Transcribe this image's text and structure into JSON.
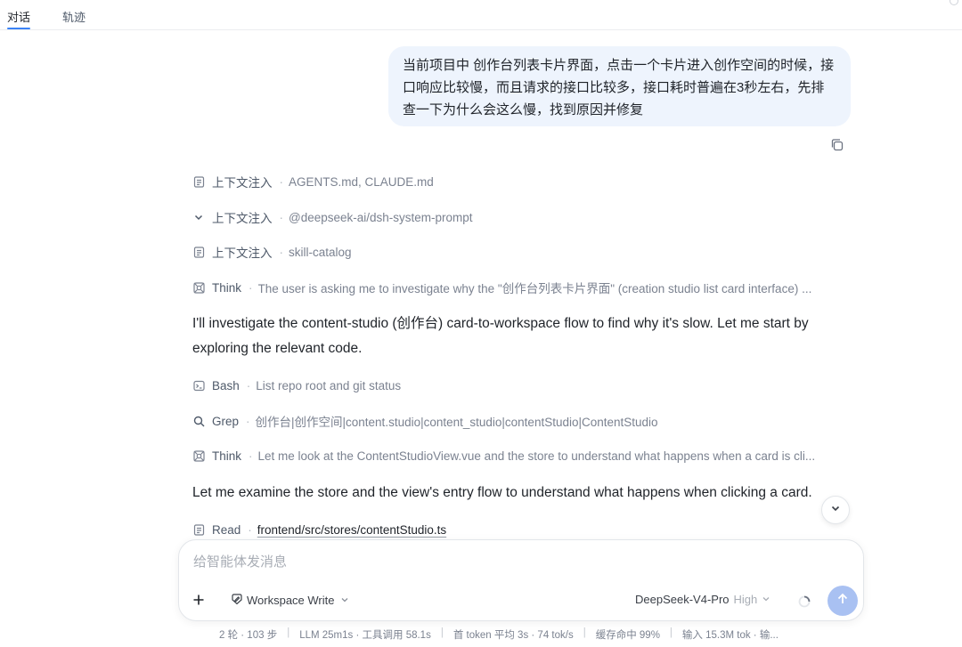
{
  "tabs": [
    {
      "label": "对话",
      "active": true
    },
    {
      "label": "轨迹",
      "active": false
    }
  ],
  "user_message": "当前项目中 创作台列表卡片界面，点击一个卡片进入创作空间的时候，接口响应比较慢，而且请求的接口比较多，接口耗时普遍在3秒左右，先排查一下为什么会这么慢，找到原因并修复",
  "steps": [
    {
      "icon": "document-icon",
      "label": "上下文注入",
      "detail": "AGENTS.md, CLAUDE.md"
    },
    {
      "icon": "chevron-down-icon",
      "label": "上下文注入",
      "detail": "@deepseek-ai/dsh-system-prompt"
    },
    {
      "icon": "document-icon",
      "label": "上下文注入",
      "detail": "skill-catalog"
    },
    {
      "icon": "think-icon",
      "label": "Think",
      "detail": "The user is asking me to investigate why the \"创作台列表卡片界面\" (creation studio list card interface) ..."
    },
    {
      "icon": "terminal-icon",
      "label": "Bash",
      "detail": "List repo root and git status"
    },
    {
      "icon": "search-icon",
      "label": "Grep",
      "detail": "创作台|创作空间|content.studio|content_studio|contentStudio|ContentStudio"
    },
    {
      "icon": "think-icon",
      "label": "Think",
      "detail": "Let me look at the ContentStudioView.vue and the store to understand what happens when a card is cli..."
    },
    {
      "icon": "document-icon",
      "label": "Read",
      "detail": "frontend/src/stores/contentStudio.ts"
    }
  ],
  "assistant_messages": [
    "I'll investigate the content-studio (创作台) card-to-workspace flow to find why it's slow. Let me start by exploring the relevant code.",
    "Let me examine the store and the view's entry flow to understand what happens when clicking a card."
  ],
  "composer": {
    "placeholder": "给智能体发消息",
    "workspace_mode": "Workspace Write",
    "model": "DeepSeek-V4-Pro",
    "effort": "High"
  },
  "status_bar": [
    "2 轮 · 103 步",
    "LLM 25m1s · 工具调用 58.1s",
    "首 token 平均 3s · 74 tok/s",
    "缓存命中 99%",
    "输入 15.3M tok · 输..."
  ],
  "colors": {
    "accent": "#3b82f6",
    "user_bubble": "#eef4fd",
    "send_button": "#a9c1f2"
  }
}
